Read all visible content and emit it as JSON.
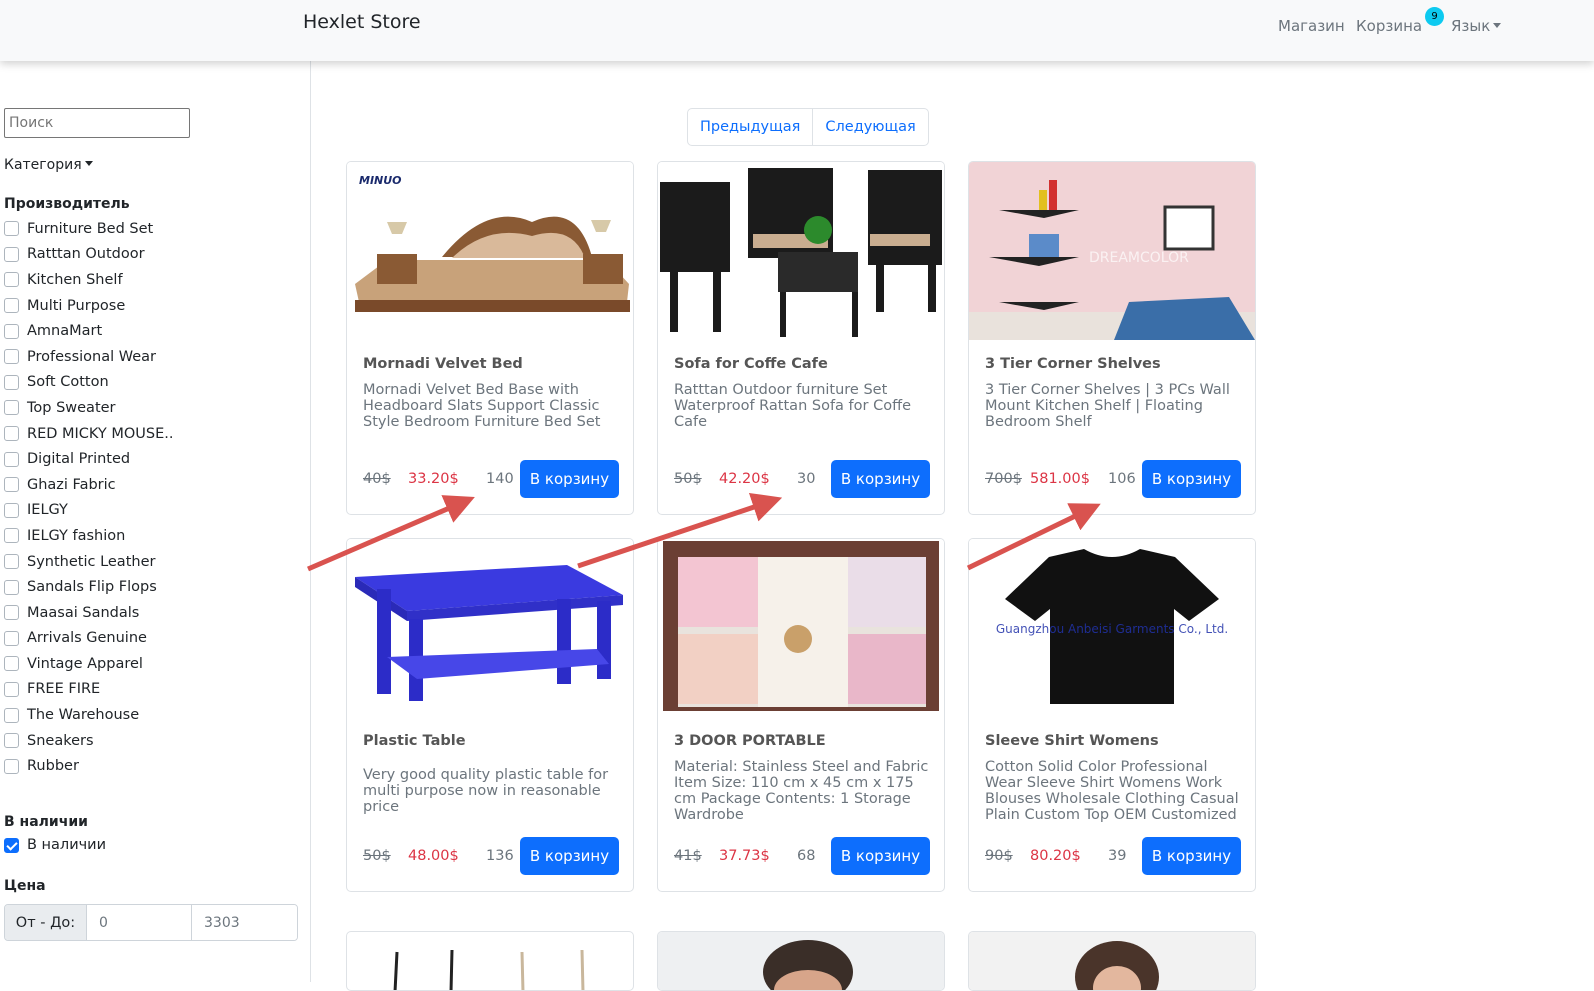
{
  "navbar": {
    "brand": "Hexlet Store",
    "links": {
      "shop": "Магазин",
      "cart": "Корзина",
      "cart_count": "9",
      "language": "Язык"
    }
  },
  "sidebar": {
    "search_placeholder": "Поиск",
    "category_label": "Категория",
    "manufacturer_title": "Производитель",
    "manufacturers": [
      "Furniture Bed Set",
      "Ratttan Outdoor",
      "Kitchen Shelf",
      "Multi Purpose",
      "AmnaMart",
      "Professional Wear",
      "Soft Cotton",
      "Top Sweater",
      "RED MICKY MOUSE..",
      "Digital Printed",
      "Ghazi Fabric",
      "IELGY",
      "IELGY fashion",
      "Synthetic Leather",
      "Sandals Flip Flops",
      "Maasai Sandals",
      "Arrivals Genuine",
      "Vintage Apparel",
      "FREE FIRE",
      "The Warehouse",
      "Sneakers",
      "Rubber"
    ],
    "availability_title": "В наличии",
    "availability_option": "В наличии",
    "availability_checked": true,
    "price_title": "Цена",
    "price_label": "От - До:",
    "price_from": "0",
    "price_to": "3303"
  },
  "pagination": {
    "prev": "Предыдущая",
    "next": "Следующая"
  },
  "products": [
    {
      "title": "Mornadi Velvet Bed",
      "description": "Mornadi Velvet Bed Base with Headboard Slats Support Classic Style Bedroom Furniture Bed Set",
      "old_price": "40$",
      "price": "33.20$",
      "qty": "140",
      "button": "В корзину",
      "image": "bed-image",
      "logo_text": "MINUO"
    },
    {
      "title": "Sofa for Coffe Cafe",
      "description": "Ratttan Outdoor furniture Set Waterproof Rattan Sofa for Coffe Cafe",
      "old_price": "50$",
      "price": "42.20$",
      "qty": "30",
      "button": "В корзину",
      "image": "rattan-chairs-image"
    },
    {
      "title": "3 Tier Corner Shelves",
      "description": "3 Tier Corner Shelves | 3 PCs Wall Mount Kitchen Shelf | Floating Bedroom Shelf",
      "old_price": "700$",
      "price": "581.00$",
      "qty": "106",
      "button": "В корзину",
      "image": "corner-shelves-image",
      "watermark": "DREAMCOLOR"
    },
    {
      "title": "Plastic Table",
      "description": "Very good quality plastic table for multi purpose now in reasonable price",
      "old_price": "50$",
      "price": "48.00$",
      "qty": "136",
      "button": "В корзину",
      "image": "plastic-table-image"
    },
    {
      "title": "3 DOOR PORTABLE",
      "description": "Material: Stainless Steel and Fabric Item Size: 110 cm x 45 cm x 175 cm Package Contents: 1 Storage Wardrobe",
      "old_price": "41$",
      "price": "37.73$",
      "qty": "68",
      "button": "В корзину",
      "image": "wardrobe-image"
    },
    {
      "title": "Sleeve Shirt Womens",
      "description": "Cotton Solid Color Professional Wear Sleeve Shirt Womens Work Blouses Wholesale Clothing Casual Plain Custom Top OEM Customized",
      "old_price": "90$",
      "price": "80.20$",
      "qty": "39",
      "button": "В корзину",
      "image": "black-tshirt-image",
      "watermark": "Guangzhou Anbeisi Garments Co., Ltd."
    }
  ],
  "colors": {
    "primary": "#0d6efd",
    "price_red": "#dc3545",
    "arrow_red": "#d9534f",
    "badge": "#0dcaf0"
  }
}
